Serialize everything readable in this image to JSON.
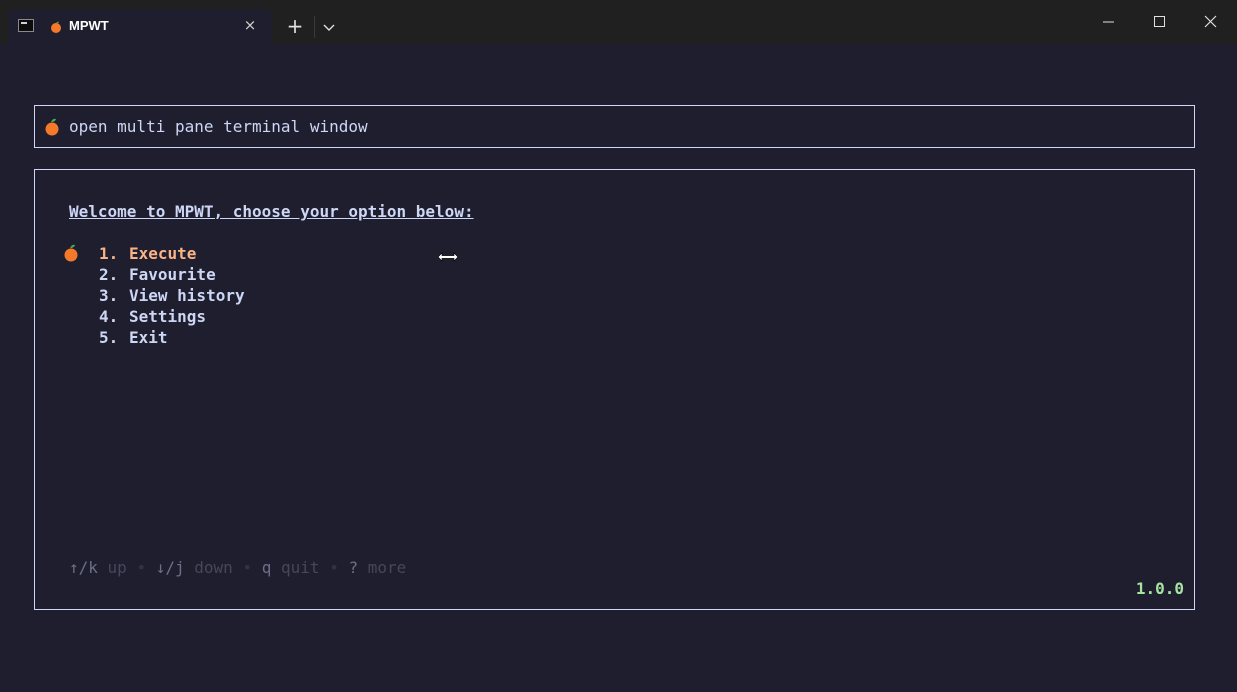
{
  "window": {
    "tab_title": "MPWT",
    "tab_close_icon": "×",
    "new_tab_icon": "+"
  },
  "prompt": {
    "text": "open multi pane terminal window"
  },
  "menu": {
    "heading": "Welcome to MPWT, choose your option below:",
    "items": [
      {
        "num": "1.",
        "label": "Execute",
        "selected": true
      },
      {
        "num": "2.",
        "label": "Favourite",
        "selected": false
      },
      {
        "num": "3.",
        "label": "View history",
        "selected": false
      },
      {
        "num": "4.",
        "label": "Settings",
        "selected": false
      },
      {
        "num": "5.",
        "label": "Exit",
        "selected": false
      }
    ]
  },
  "help": {
    "up_key": "↑/k",
    "up_desc": "up",
    "down_key": "↓/j",
    "down_desc": "down",
    "quit_key": "q",
    "quit_desc": "quit",
    "more_key": "?",
    "more_desc": "more",
    "separator": "•"
  },
  "version": "1.0.0",
  "colors": {
    "background": "#1e1e2e",
    "text": "#cdd6f4",
    "selected": "#fab387",
    "version": "#a6e3a1",
    "orange_icon": "#f5792a"
  }
}
